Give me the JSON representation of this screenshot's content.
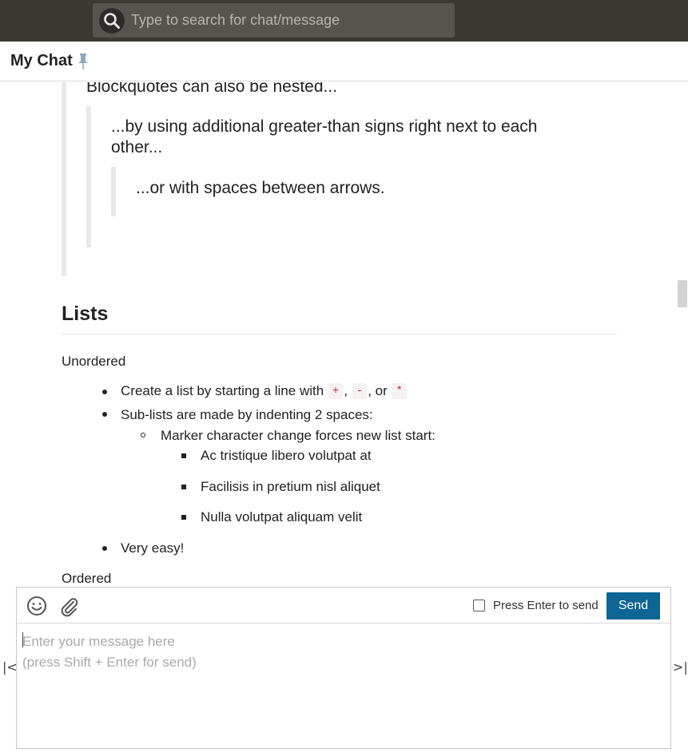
{
  "search": {
    "placeholder": "Type to search for chat/message"
  },
  "chat": {
    "title": "My Chat"
  },
  "blockquotes": {
    "level1": "Blockquotes can also be nested...",
    "level2_line1": "...by using additional greater-than signs right next to each",
    "level2_line2": "other...",
    "level3": "...or with spaces between arrows."
  },
  "lists": {
    "heading": "Lists",
    "unordered_label": "Unordered",
    "item1_prefix": "Create a list by starting a line with",
    "code_plus": "+",
    "code_minus": "-",
    "code_star": "*",
    "sep1": ",",
    "sep2": ", or",
    "item2": "Sub-lists are made by indenting 2 spaces:",
    "subitem": "Marker character change forces new list start:",
    "subsub": [
      "Ac tristique libero volutpat at",
      "Facilisis in pretium nisl aliquet",
      "Nulla volutpat aliquam velit"
    ],
    "item3": "Very easy!",
    "ordered_label": "Ordered"
  },
  "composer": {
    "enter_to_send_label": "Press Enter to send",
    "enter_to_send_checked": false,
    "send_label": "Send",
    "placeholder": "Enter your message here\n(press Shift + Enter for send)"
  },
  "nav": {
    "prev": "|<",
    "next": ">|"
  },
  "colors": {
    "topbar": "#3a3932",
    "send_button": "#0d6594",
    "code_text": "#c7254e"
  }
}
